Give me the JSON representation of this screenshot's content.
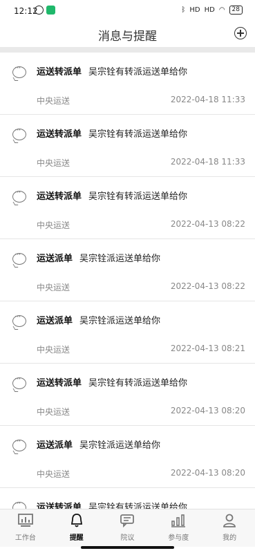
{
  "status": {
    "time": "12:12",
    "network1": "HD",
    "network2": "HD",
    "battery": "28"
  },
  "header": {
    "title": "消息与提醒"
  },
  "messages": [
    {
      "type": "运送转派单",
      "text": "吴宗铨有转派运送单给你",
      "org": "中央运送",
      "date": "2022-04-18 11:33"
    },
    {
      "type": "运送转派单",
      "text": "吴宗铨有转派运送单给你",
      "org": "中央运送",
      "date": "2022-04-18 11:33"
    },
    {
      "type": "运送转派单",
      "text": "吴宗铨有转派运送单给你",
      "org": "中央运送",
      "date": "2022-04-13 08:22"
    },
    {
      "type": "运送派单",
      "text": "吴宗铨派运送单给你",
      "org": "中央运送",
      "date": "2022-04-13 08:22"
    },
    {
      "type": "运送派单",
      "text": "吴宗铨派运送单给你",
      "org": "中央运送",
      "date": "2022-04-13 08:21"
    },
    {
      "type": "运送转派单",
      "text": "吴宗铨有转派运送单给你",
      "org": "中央运送",
      "date": "2022-04-13 08:20"
    },
    {
      "type": "运送派单",
      "text": "吴宗铨派运送单给你",
      "org": "中央运送",
      "date": "2022-04-13 08:20"
    },
    {
      "type": "运送转派单",
      "text": "吴宗铨有转派运送单给你",
      "org": "",
      "date": ""
    }
  ],
  "tabs": [
    {
      "label": "工作台",
      "icon": "dashboard-icon"
    },
    {
      "label": "提醒",
      "icon": "bell-icon",
      "active": true
    },
    {
      "label": "院议",
      "icon": "chat-icon"
    },
    {
      "label": "参与度",
      "icon": "bar-chart-icon"
    },
    {
      "label": "我的",
      "icon": "user-icon"
    }
  ]
}
